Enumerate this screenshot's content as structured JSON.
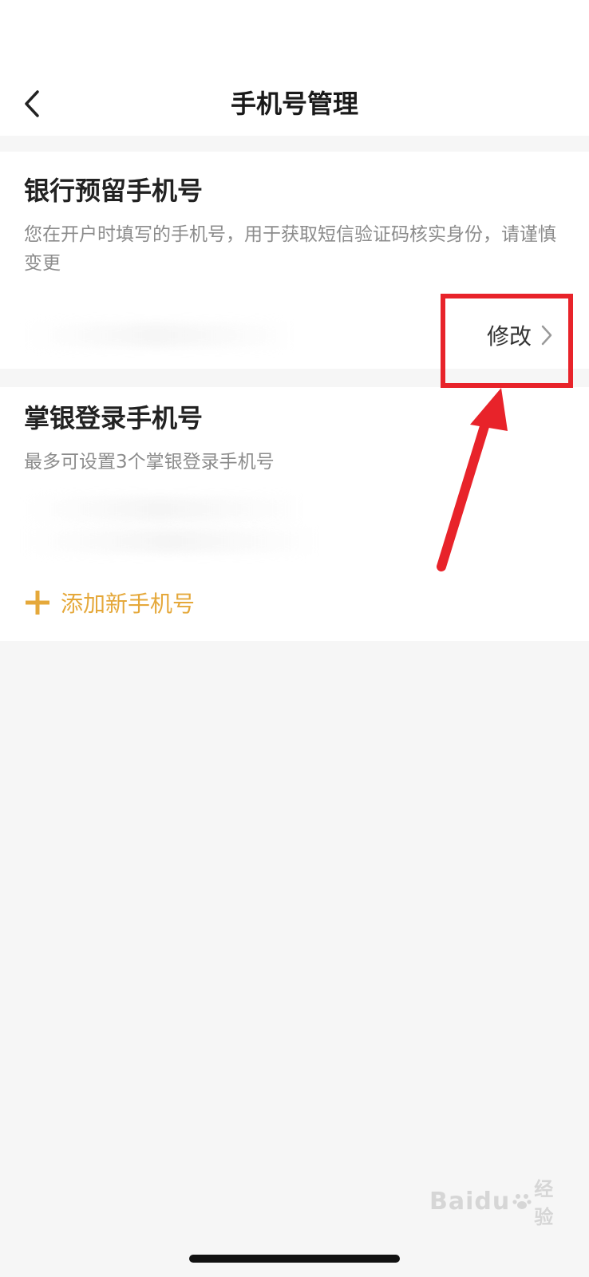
{
  "nav": {
    "title": "手机号管理",
    "back_icon": "chevron-left-icon"
  },
  "bank_reserved": {
    "title": "银行预留手机号",
    "description": "您在开户时填写的手机号，用于获取短信验证码核实身份，请谨慎变更",
    "modify_label": "修改",
    "modify_icon": "chevron-right-icon"
  },
  "login_phones": {
    "title": "掌银登录手机号",
    "description": "最多可设置3个掌银登录手机号",
    "add_label": "添加新手机号",
    "add_icon": "plus-icon"
  },
  "annotation": {
    "highlight_color": "#e8232a"
  },
  "watermark": {
    "logo": "Baidu",
    "text": "经验"
  },
  "colors": {
    "accent": "#e5a83a",
    "background": "#f6f6f6",
    "card": "#ffffff"
  }
}
